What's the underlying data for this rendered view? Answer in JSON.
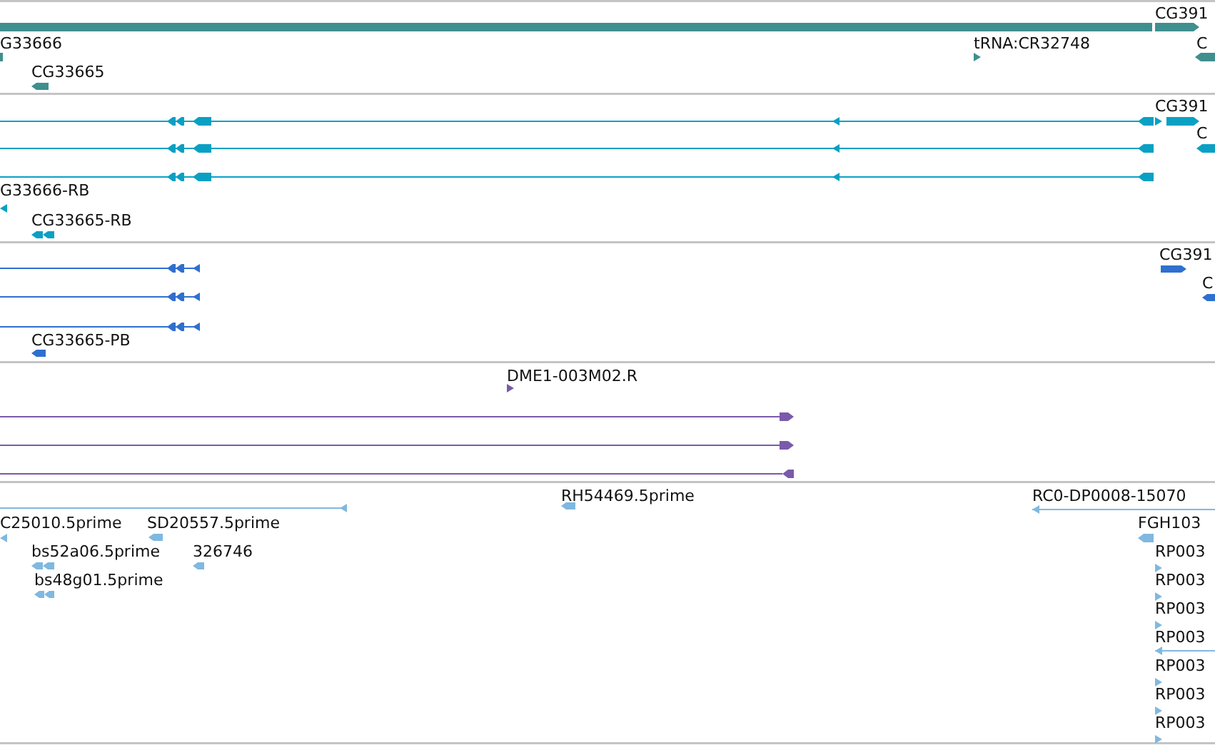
{
  "tracks": [
    {
      "color": "#3f8f8f",
      "labels": [
        "CG391",
        "G33666",
        "tRNA:CR32748",
        "C",
        "CG33665"
      ]
    },
    {
      "color": "#0aa0c4",
      "labels": [
        "CG391",
        "C",
        "G33666-RB",
        "CG33665-RB"
      ]
    },
    {
      "color": "#2f6fd0",
      "labels": [
        "CG391",
        "C",
        "CG33665-PB"
      ]
    },
    {
      "color": "#7a5aaa",
      "labels": [
        "DME1-003M02.R"
      ]
    },
    {
      "color": "#80b8e0",
      "labels": [
        "RH54469.5prime",
        "RC0-DP0008-15070",
        "C25010.5prime",
        "SD20557.5prime",
        "FGH103",
        "bs52a06.5prime",
        "326746",
        "RP003",
        "bs48g01.5prime",
        "RP003",
        "RP003",
        "RP003",
        "RP003",
        "RP003",
        "RP003"
      ]
    }
  ]
}
